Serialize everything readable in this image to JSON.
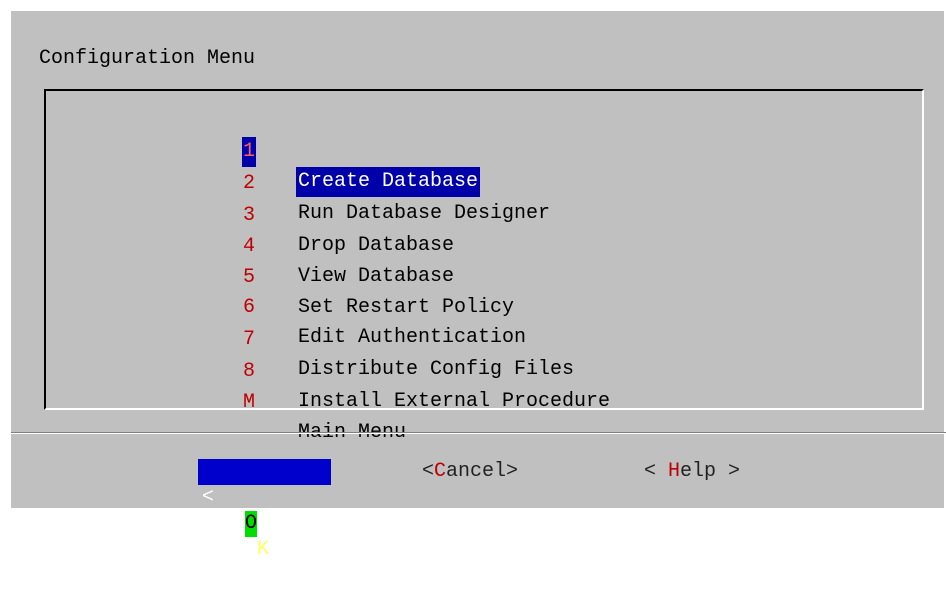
{
  "dialog": {
    "title": "Configuration Menu"
  },
  "menu": {
    "selected_index": 0,
    "items": [
      {
        "key": "1",
        "label": "Create Database"
      },
      {
        "key": "2",
        "label": "Run Database Designer"
      },
      {
        "key": "3",
        "label": "Drop Database"
      },
      {
        "key": "4",
        "label": "View Database"
      },
      {
        "key": "5",
        "label": "Set Restart Policy"
      },
      {
        "key": "6",
        "label": "Edit Authentication"
      },
      {
        "key": "7",
        "label": "Distribute Config Files"
      },
      {
        "key": "8",
        "label": "Install External Procedure"
      },
      {
        "key": "M",
        "label": "Main Menu"
      }
    ]
  },
  "buttons": {
    "ok": {
      "open": "<",
      "hotkey": "O",
      "rest": "K",
      "close": ">"
    },
    "cancel": {
      "open": "<",
      "hotkey": "C",
      "rest": "ancel",
      "close": ">"
    },
    "help": {
      "open": "< ",
      "hotkey": "H",
      "rest": "elp",
      "close": " >"
    }
  },
  "colors": {
    "dialog_background": "#c0c0c0",
    "selection_background": "#0000aa",
    "hotkey": "#c00000",
    "ok_hotkey_background": "#00dd00"
  }
}
